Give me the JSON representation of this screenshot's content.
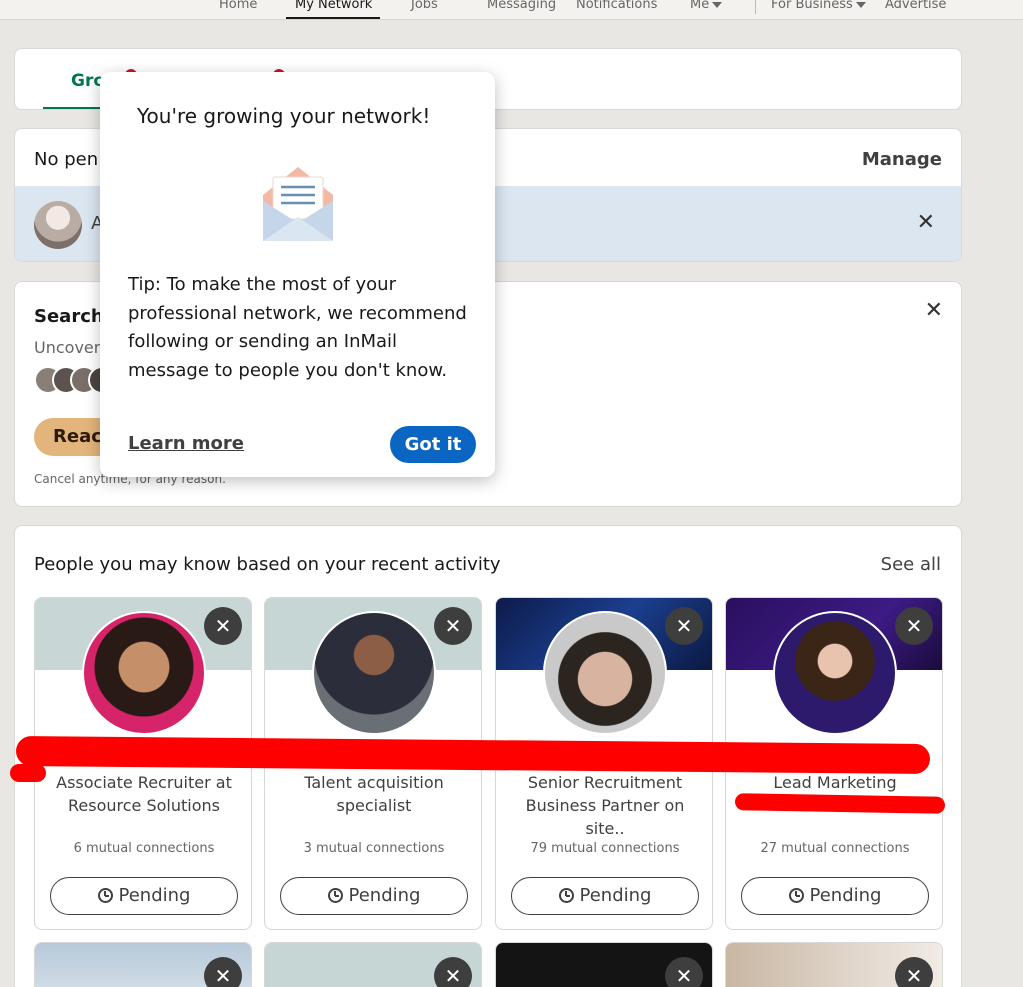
{
  "nav": {
    "items": [
      "Home",
      "My Network",
      "Jobs",
      "Messaging",
      "Notifications",
      "Me",
      "For Business",
      "Advertise"
    ]
  },
  "tabs": {
    "first_label": "Gro"
  },
  "invitations": {
    "title": "No pen",
    "manage_label": "Manage",
    "row_name": "A"
  },
  "premium": {
    "title": "Searchi",
    "subtitle": "Uncover",
    "button_label": "React",
    "cancel_text": "Cancel anytime, for any reason."
  },
  "pymk": {
    "title": "People you may know based on your recent activity",
    "see_all": "See all",
    "cards": [
      {
        "headline": "Associate Recruiter at Resource Solutions",
        "mutual": "6 mutual connections",
        "pending": "Pending"
      },
      {
        "headline": "Talent acquisition specialist",
        "mutual": "3 mutual connections",
        "pending": "Pending"
      },
      {
        "headline": "Senior Recruitment Business Partner on site..",
        "mutual": "79 mutual connections",
        "pending": "Pending"
      },
      {
        "headline": "Lead Marketing Executive",
        "mutual": "27 mutual connections",
        "pending": "Pending"
      }
    ]
  },
  "modal": {
    "title": "You're growing your network!",
    "icon": "envelope-icon",
    "body": "Tip: To make the most of your professional network, we recommend following or sending an InMail message to people you don't know.",
    "learn_more": "Learn more",
    "got_it": "Got it"
  },
  "colors": {
    "primary": "#0a66c2",
    "accent_green": "#01754f",
    "annotation_red": "#ff0000"
  }
}
